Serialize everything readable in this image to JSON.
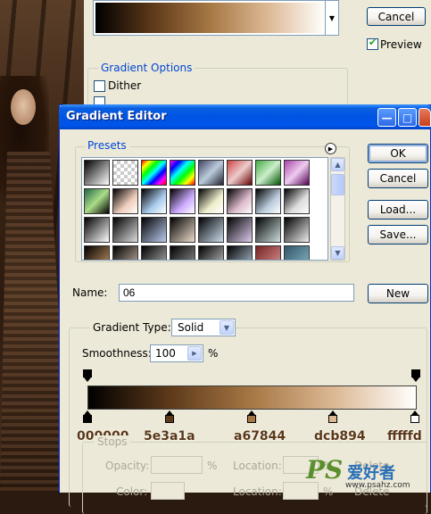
{
  "back_dialog": {
    "cancel_label": "Cancel",
    "preview_label": "Preview",
    "preview_checked": true,
    "gradient_options_title": "Gradient Options",
    "dither_label": "Dither",
    "gradient_colors": [
      "#000000",
      "#5e3a1a",
      "#a67844",
      "#dcb894",
      "#fffffd"
    ]
  },
  "editor": {
    "title": "Gradient Editor",
    "presets_title": "Presets",
    "ok_label": "OK",
    "cancel_label": "Cancel",
    "load_label": "Load...",
    "save_label": "Save...",
    "name_label": "Name:",
    "name_value": "06",
    "new_label": "New",
    "gradient_type_label": "Gradient Type:",
    "gradient_type_value": "Solid",
    "smoothness_label": "Smoothness:",
    "smoothness_value": "100",
    "smoothness_unit": "%",
    "stops": {
      "title": "Stops",
      "opacity_label": "Opacity:",
      "opacity_unit": "%",
      "location_label": "Location:",
      "location_unit": "%",
      "color_label": "Color:",
      "location2_label": "Location:",
      "location2_unit": "%",
      "delete_label": "Delete",
      "delete2_label": "Delete"
    },
    "color_stops": [
      {
        "hex_label": "000000",
        "color": "#000000",
        "location": 0
      },
      {
        "hex_label": "5e3a1a",
        "color": "#5e3a1a",
        "location": 25
      },
      {
        "hex_label": "a67844",
        "color": "#a67844",
        "location": 50
      },
      {
        "hex_label": "dcb894",
        "color": "#dcb894",
        "location": 75
      },
      {
        "hex_label": "fffffd",
        "color": "#fffffd",
        "location": 100
      }
    ],
    "opacity_stops": [
      {
        "location": 0,
        "opacity": 100
      },
      {
        "location": 100,
        "opacity": 100
      }
    ]
  },
  "watermark": {
    "logo_text": "PS",
    "cn_text": "爱好者",
    "url": "www.psahz.com"
  }
}
